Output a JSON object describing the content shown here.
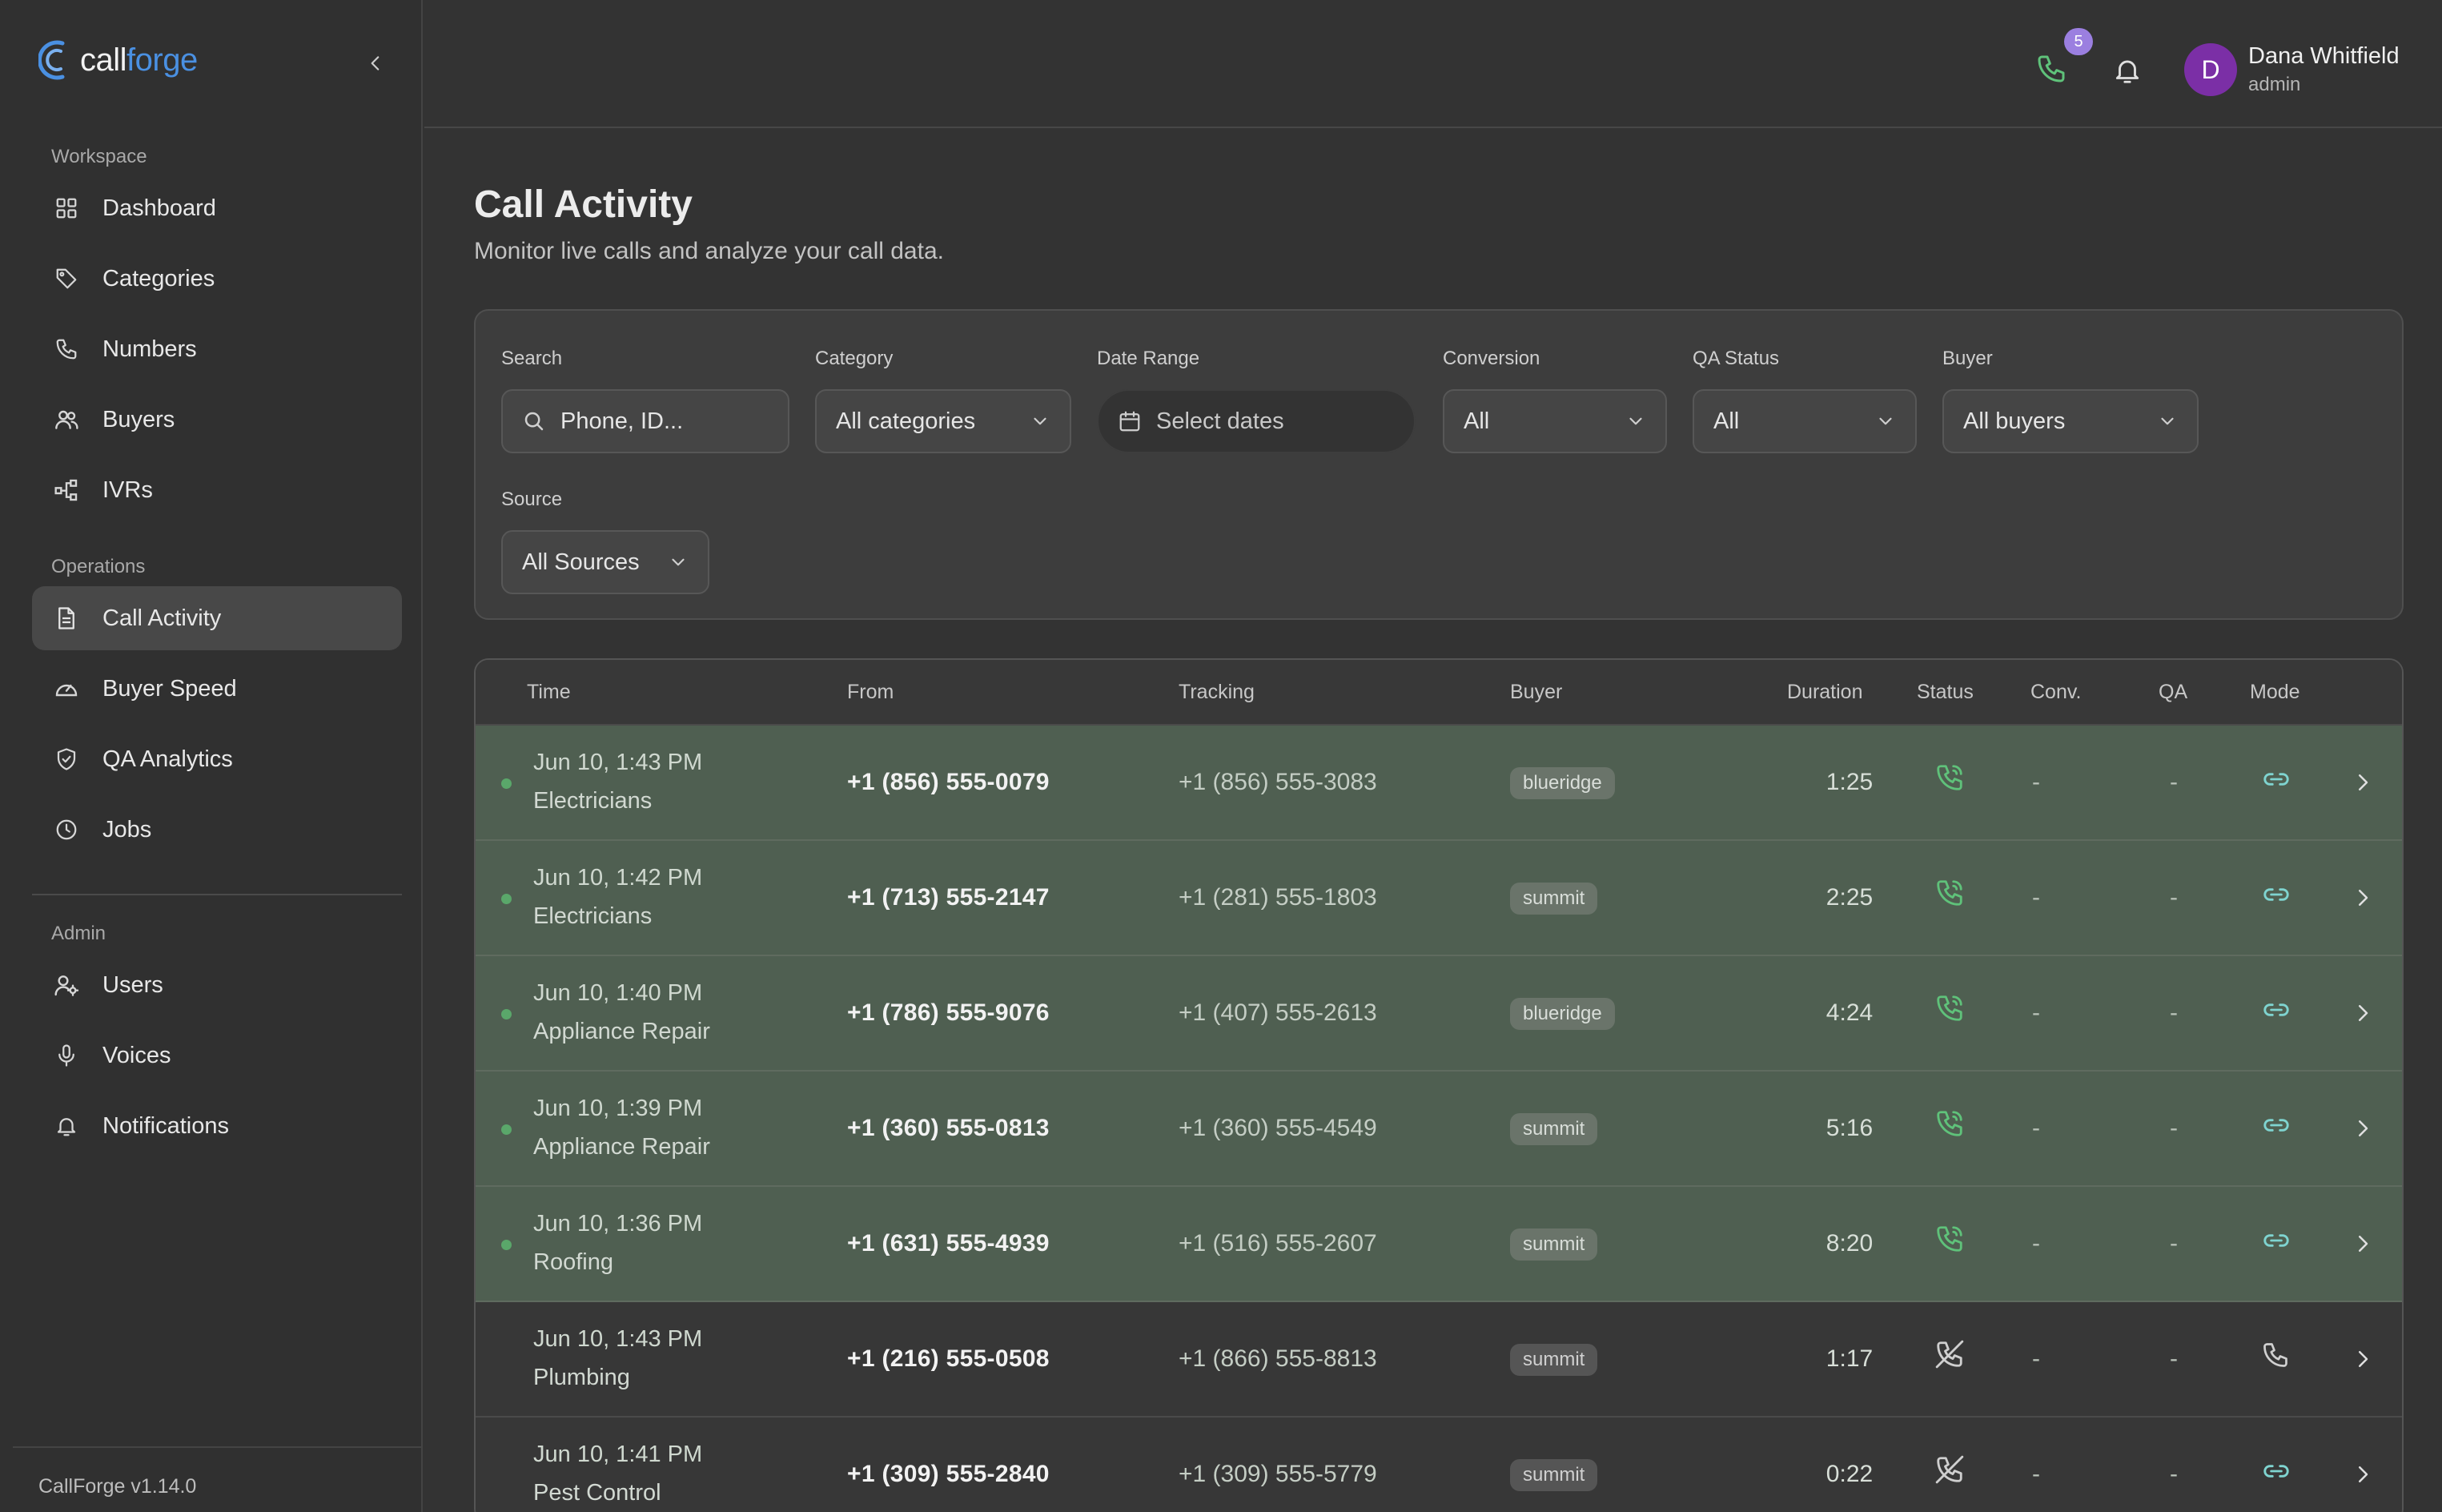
{
  "app": {
    "name_left": "call",
    "name_right": "forge",
    "version": "CallForge v1.14.0"
  },
  "sidebar": {
    "sections": [
      {
        "label": "Workspace"
      },
      {
        "label": "Operations"
      },
      {
        "label": "Admin"
      }
    ],
    "items": [
      {
        "label": "Dashboard",
        "icon": "grid-icon"
      },
      {
        "label": "Categories",
        "icon": "tag-icon"
      },
      {
        "label": "Numbers",
        "icon": "phone-icon"
      },
      {
        "label": "Buyers",
        "icon": "users-icon"
      },
      {
        "label": "IVRs",
        "icon": "flow-icon"
      },
      {
        "label": "Call Activity",
        "icon": "document-icon",
        "active": true
      },
      {
        "label": "Buyer Speed",
        "icon": "gauge-icon"
      },
      {
        "label": "QA Analytics",
        "icon": "shield-check-icon"
      },
      {
        "label": "Jobs",
        "icon": "clock-icon"
      },
      {
        "label": "Users",
        "icon": "user-cog-icon"
      },
      {
        "label": "Voices",
        "icon": "microphone-icon"
      },
      {
        "label": "Notifications",
        "icon": "bell-icon"
      }
    ]
  },
  "header": {
    "call_badge": "5",
    "user": {
      "initial": "D",
      "name": "Dana Whitfield",
      "role": "admin"
    }
  },
  "page": {
    "title": "Call Activity",
    "subtitle": "Monitor live calls and analyze your call data."
  },
  "filters": {
    "search": {
      "label": "Search",
      "placeholder": "Phone, ID..."
    },
    "category": {
      "label": "Category",
      "value": "All categories"
    },
    "date_range": {
      "label": "Date Range",
      "placeholder": "Select dates"
    },
    "conversion": {
      "label": "Conversion",
      "value": "All"
    },
    "qa_status": {
      "label": "QA Status",
      "value": "All"
    },
    "buyer": {
      "label": "Buyer",
      "value": "All buyers"
    },
    "source": {
      "label": "Source",
      "value": "All Sources"
    }
  },
  "table": {
    "columns": [
      "Time",
      "From",
      "Tracking",
      "Buyer",
      "Duration",
      "Status",
      "Conv.",
      "QA",
      "Mode"
    ],
    "rows": [
      {
        "time": "Jun 10, 1:43 PM",
        "category": "Electricians",
        "from": "+1 (856) 555-0079",
        "tracking": "+1 (856) 555-3083",
        "buyer": "blueridge",
        "duration": "1:25",
        "conv": "-",
        "qa": "-",
        "live": true,
        "status_icon": "phone-active-icon",
        "mode_icon": "link-icon"
      },
      {
        "time": "Jun 10, 1:42 PM",
        "category": "Electricians",
        "from": "+1 (713) 555-2147",
        "tracking": "+1 (281) 555-1803",
        "buyer": "summit",
        "duration": "2:25",
        "conv": "-",
        "qa": "-",
        "live": true,
        "status_icon": "phone-active-icon",
        "mode_icon": "link-icon"
      },
      {
        "time": "Jun 10, 1:40 PM",
        "category": "Appliance Repair",
        "from": "+1 (786) 555-9076",
        "tracking": "+1 (407) 555-2613",
        "buyer": "blueridge",
        "duration": "4:24",
        "conv": "-",
        "qa": "-",
        "live": true,
        "status_icon": "phone-active-icon",
        "mode_icon": "link-icon"
      },
      {
        "time": "Jun 10, 1:39 PM",
        "category": "Appliance Repair",
        "from": "+1 (360) 555-0813",
        "tracking": "+1 (360) 555-4549",
        "buyer": "summit",
        "duration": "5:16",
        "conv": "-",
        "qa": "-",
        "live": true,
        "status_icon": "phone-active-icon",
        "mode_icon": "link-icon"
      },
      {
        "time": "Jun 10, 1:36 PM",
        "category": "Roofing",
        "from": "+1 (631) 555-4939",
        "tracking": "+1 (516) 555-2607",
        "buyer": "summit",
        "duration": "8:20",
        "conv": "-",
        "qa": "-",
        "live": true,
        "status_icon": "phone-active-icon",
        "mode_icon": "link-icon"
      },
      {
        "time": "Jun 10, 1:43 PM",
        "category": "Plumbing",
        "from": "+1 (216) 555-0508",
        "tracking": "+1 (866) 555-8813",
        "buyer": "summit",
        "duration": "1:17",
        "conv": "-",
        "qa": "-",
        "live": false,
        "status_icon": "phone-ended-icon",
        "mode_icon": "phone-icon"
      },
      {
        "time": "Jun 10, 1:41 PM",
        "category": "Pest Control",
        "from": "+1 (309) 555-2840",
        "tracking": "+1 (309) 555-5779",
        "buyer": "summit",
        "duration": "0:22",
        "conv": "-",
        "qa": "-",
        "live": false,
        "status_icon": "phone-ended-icon",
        "mode_icon": "link-icon"
      }
    ]
  },
  "colors": {
    "accent": "#4a90e2",
    "live_row": "#4f5f51",
    "live_icon": "#5fc27a",
    "badge": "#9b7fe0",
    "avatar": "#7b2fa6"
  }
}
